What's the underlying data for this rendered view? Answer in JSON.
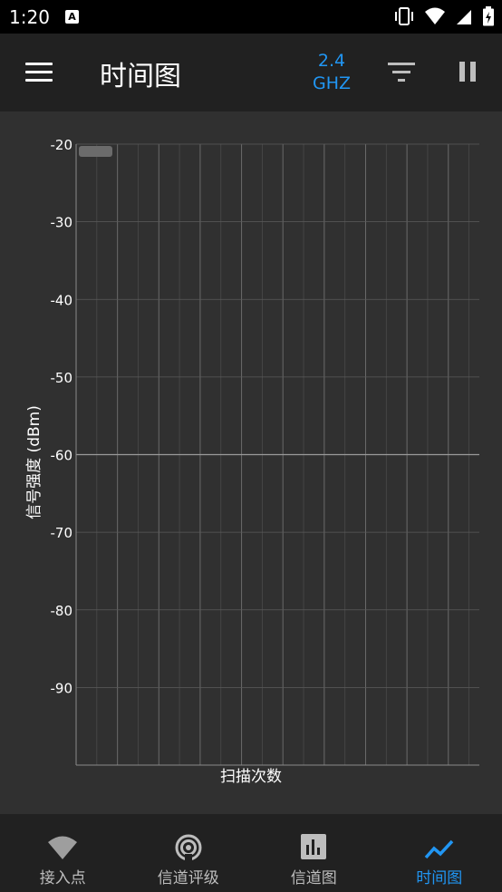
{
  "status": {
    "time": "1:20",
    "notification_icon": "a-letter-icon",
    "icons": [
      "vibrate-icon",
      "wifi-icon",
      "signal-icon",
      "battery-charging-icon"
    ]
  },
  "toolbar": {
    "title": "时间图",
    "band_line1": "2.4",
    "band_line2": "GHZ",
    "menu_icon": "menu-icon",
    "filter_icon": "filter-icon",
    "pause_icon": "pause-icon"
  },
  "colors": {
    "accent": "#2196f3",
    "background": "#303030",
    "bar": "#212121",
    "grid": "#5a5a5a",
    "text": "#ffffff",
    "inactive": "#bdbdbd"
  },
  "chart_data": {
    "type": "line",
    "title": "",
    "xlabel": "扫描次数",
    "ylabel": "信号强度 (dBm)",
    "ylim": [
      -100,
      -20
    ],
    "yticks": [
      -20,
      -30,
      -40,
      -50,
      -60,
      -70,
      -80,
      -90
    ],
    "y_tick_labels": [
      "-20",
      "-30",
      "-40",
      "-50",
      "-60",
      "-70",
      "-80",
      "-90"
    ],
    "grid": true,
    "legend": "top-left",
    "series": []
  },
  "nav": {
    "items": [
      {
        "label": "接入点",
        "icon": "wifi-icon",
        "active": false
      },
      {
        "label": "信道评级",
        "icon": "radar-icon",
        "active": false
      },
      {
        "label": "信道图",
        "icon": "bar-chart-icon",
        "active": false
      },
      {
        "label": "时间图",
        "icon": "line-chart-icon",
        "active": true
      }
    ]
  }
}
